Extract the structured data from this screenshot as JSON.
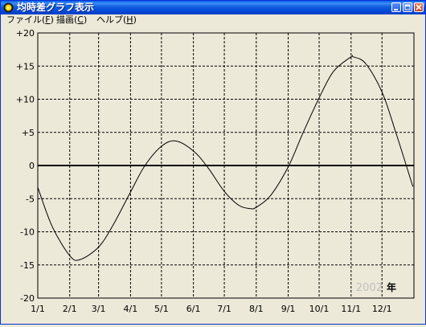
{
  "window": {
    "title": "均時差グラフ表示"
  },
  "menu": [
    {
      "label": "ファイル(",
      "accel": "F",
      "tail": ")"
    },
    {
      "label": "描画(",
      "accel": "C",
      "tail": ")"
    },
    {
      "label": "ヘルプ(",
      "accel": "H",
      "tail": ")"
    }
  ],
  "chart_data": {
    "type": "line",
    "y_tick_labels": [
      "+20",
      "+15",
      "+10",
      "+5",
      "0",
      "-5",
      "-10",
      "-15",
      "-20"
    ],
    "x_tick_labels": [
      "1/1",
      "2/1",
      "3/1",
      "4/1",
      "5/1",
      "6/1",
      "7/1",
      "8/1",
      "9/1",
      "10/1",
      "11/1",
      "12/1"
    ],
    "ylim": [
      -20,
      20
    ],
    "y_step": 5,
    "grid": true,
    "year": "2002",
    "year_unit": "年",
    "series_color": "#000000",
    "x": [
      "1/1",
      "1/15",
      "2/1",
      "2/11",
      "3/1",
      "3/15",
      "4/1",
      "4/15",
      "5/1",
      "5/15",
      "6/1",
      "6/15",
      "7/1",
      "7/15",
      "7/26",
      "8/1",
      "8/15",
      "9/1",
      "9/15",
      "10/1",
      "10/15",
      "11/1",
      "11/3",
      "11/15",
      "12/1",
      "12/15",
      "12/31"
    ],
    "values": [
      -3.3,
      -9.2,
      -13.6,
      -14.2,
      -12.3,
      -9.0,
      -4.0,
      0.0,
      2.9,
      3.7,
      2.2,
      -0.3,
      -3.9,
      -6.0,
      -6.5,
      -6.3,
      -4.5,
      -0.2,
      4.8,
      10.2,
      14.2,
      16.4,
      16.4,
      15.4,
      11.1,
      4.7,
      -3.2
    ]
  }
}
